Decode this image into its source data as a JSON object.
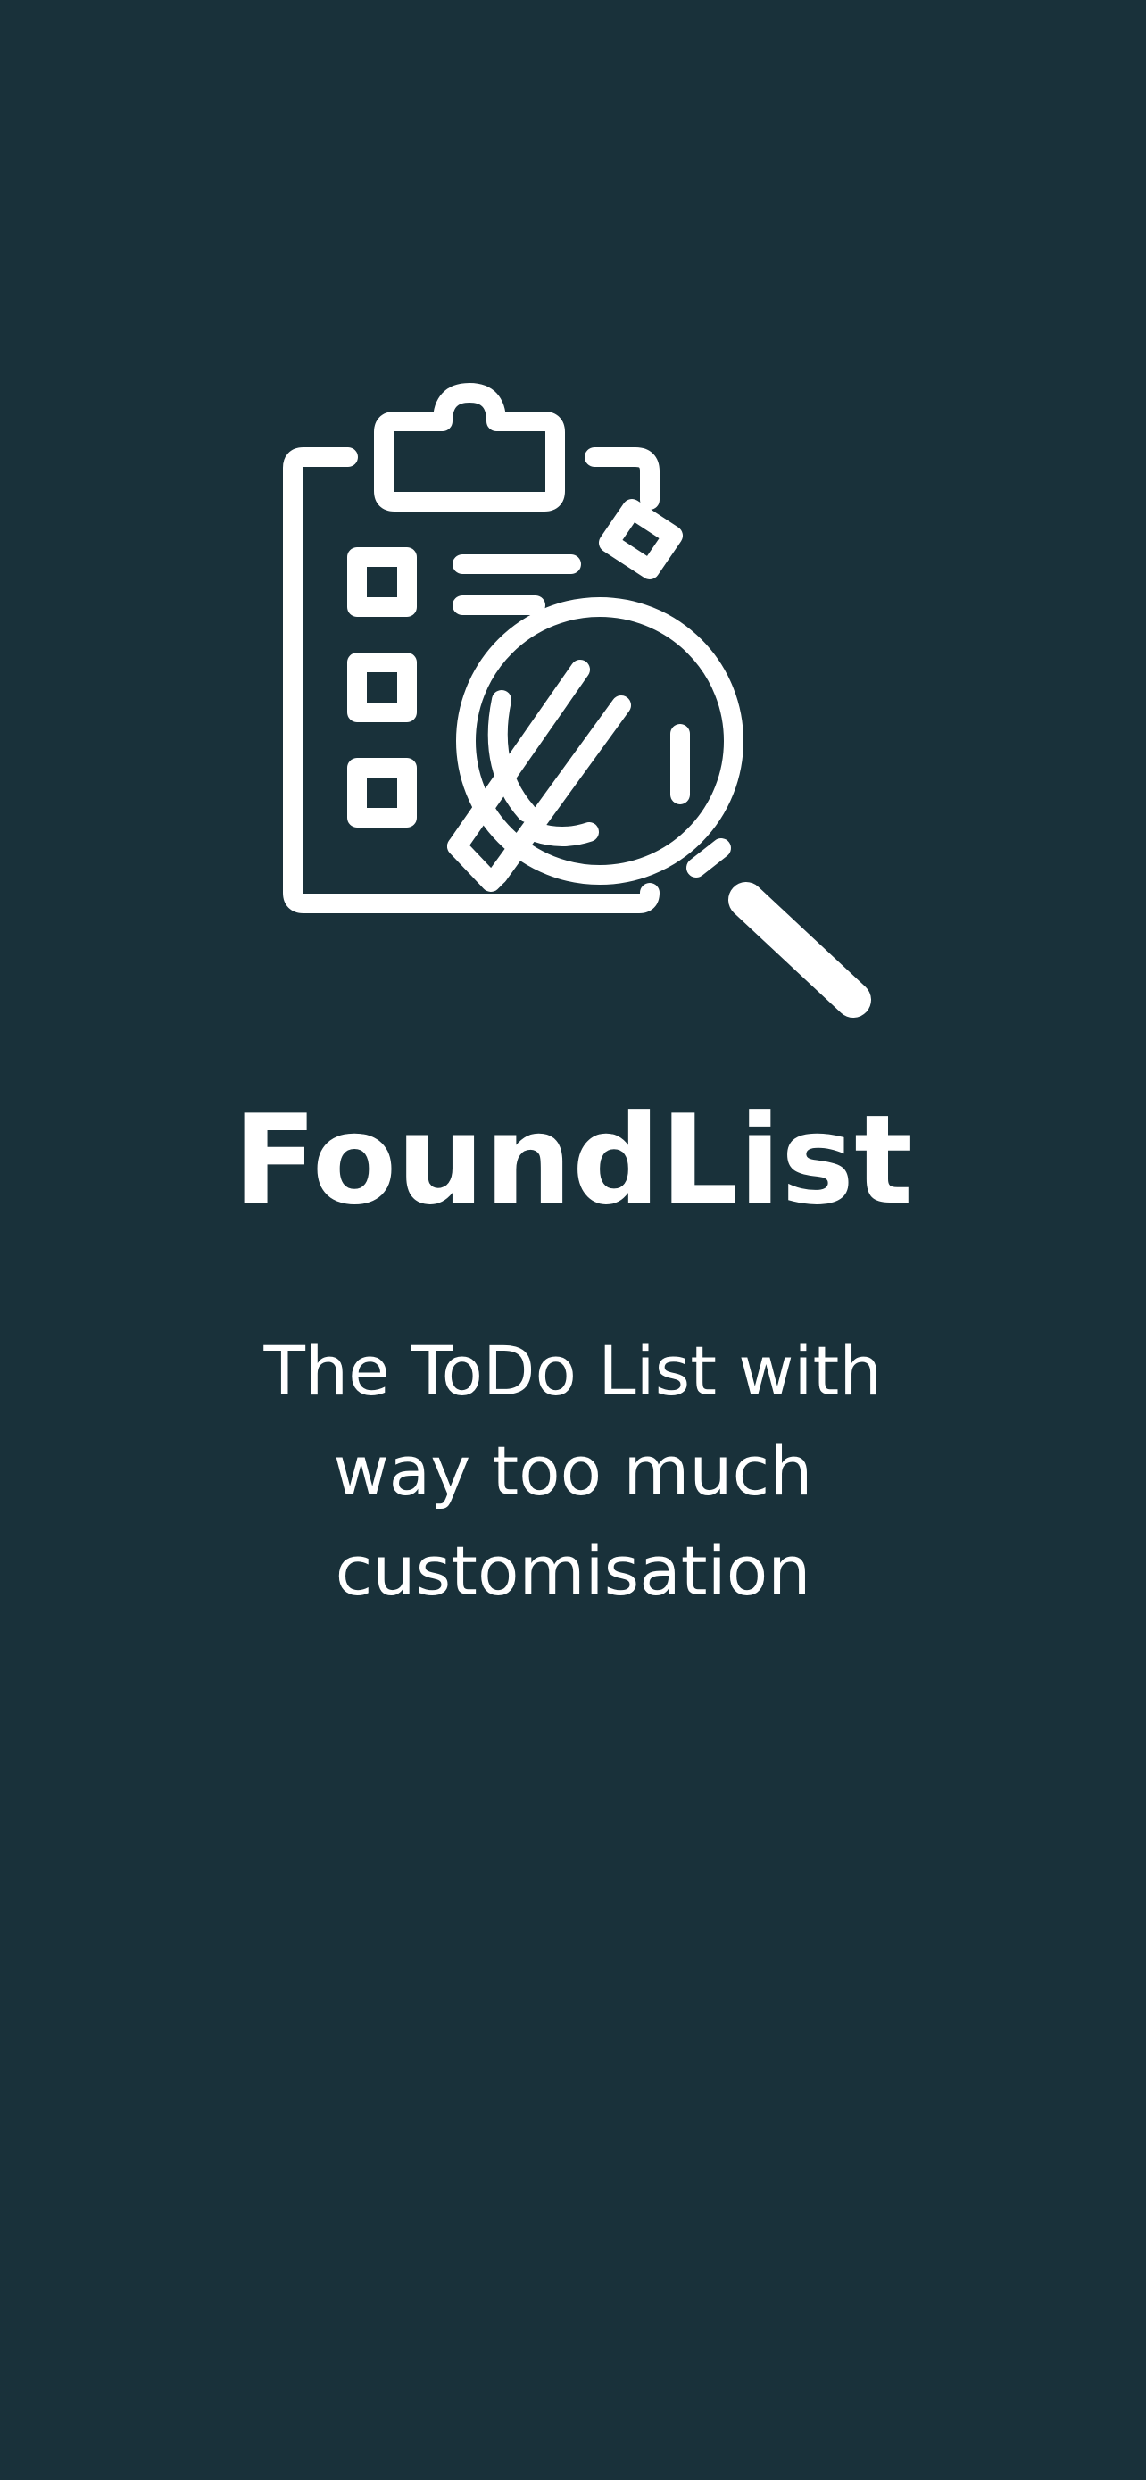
{
  "app": {
    "name": "FoundList",
    "tagline": "The ToDo List with way too much customisation",
    "logo_icon": "clipboard-checklist-magnifier-icon"
  },
  "colors": {
    "background": "#19313a",
    "foreground": "#ffffff"
  }
}
